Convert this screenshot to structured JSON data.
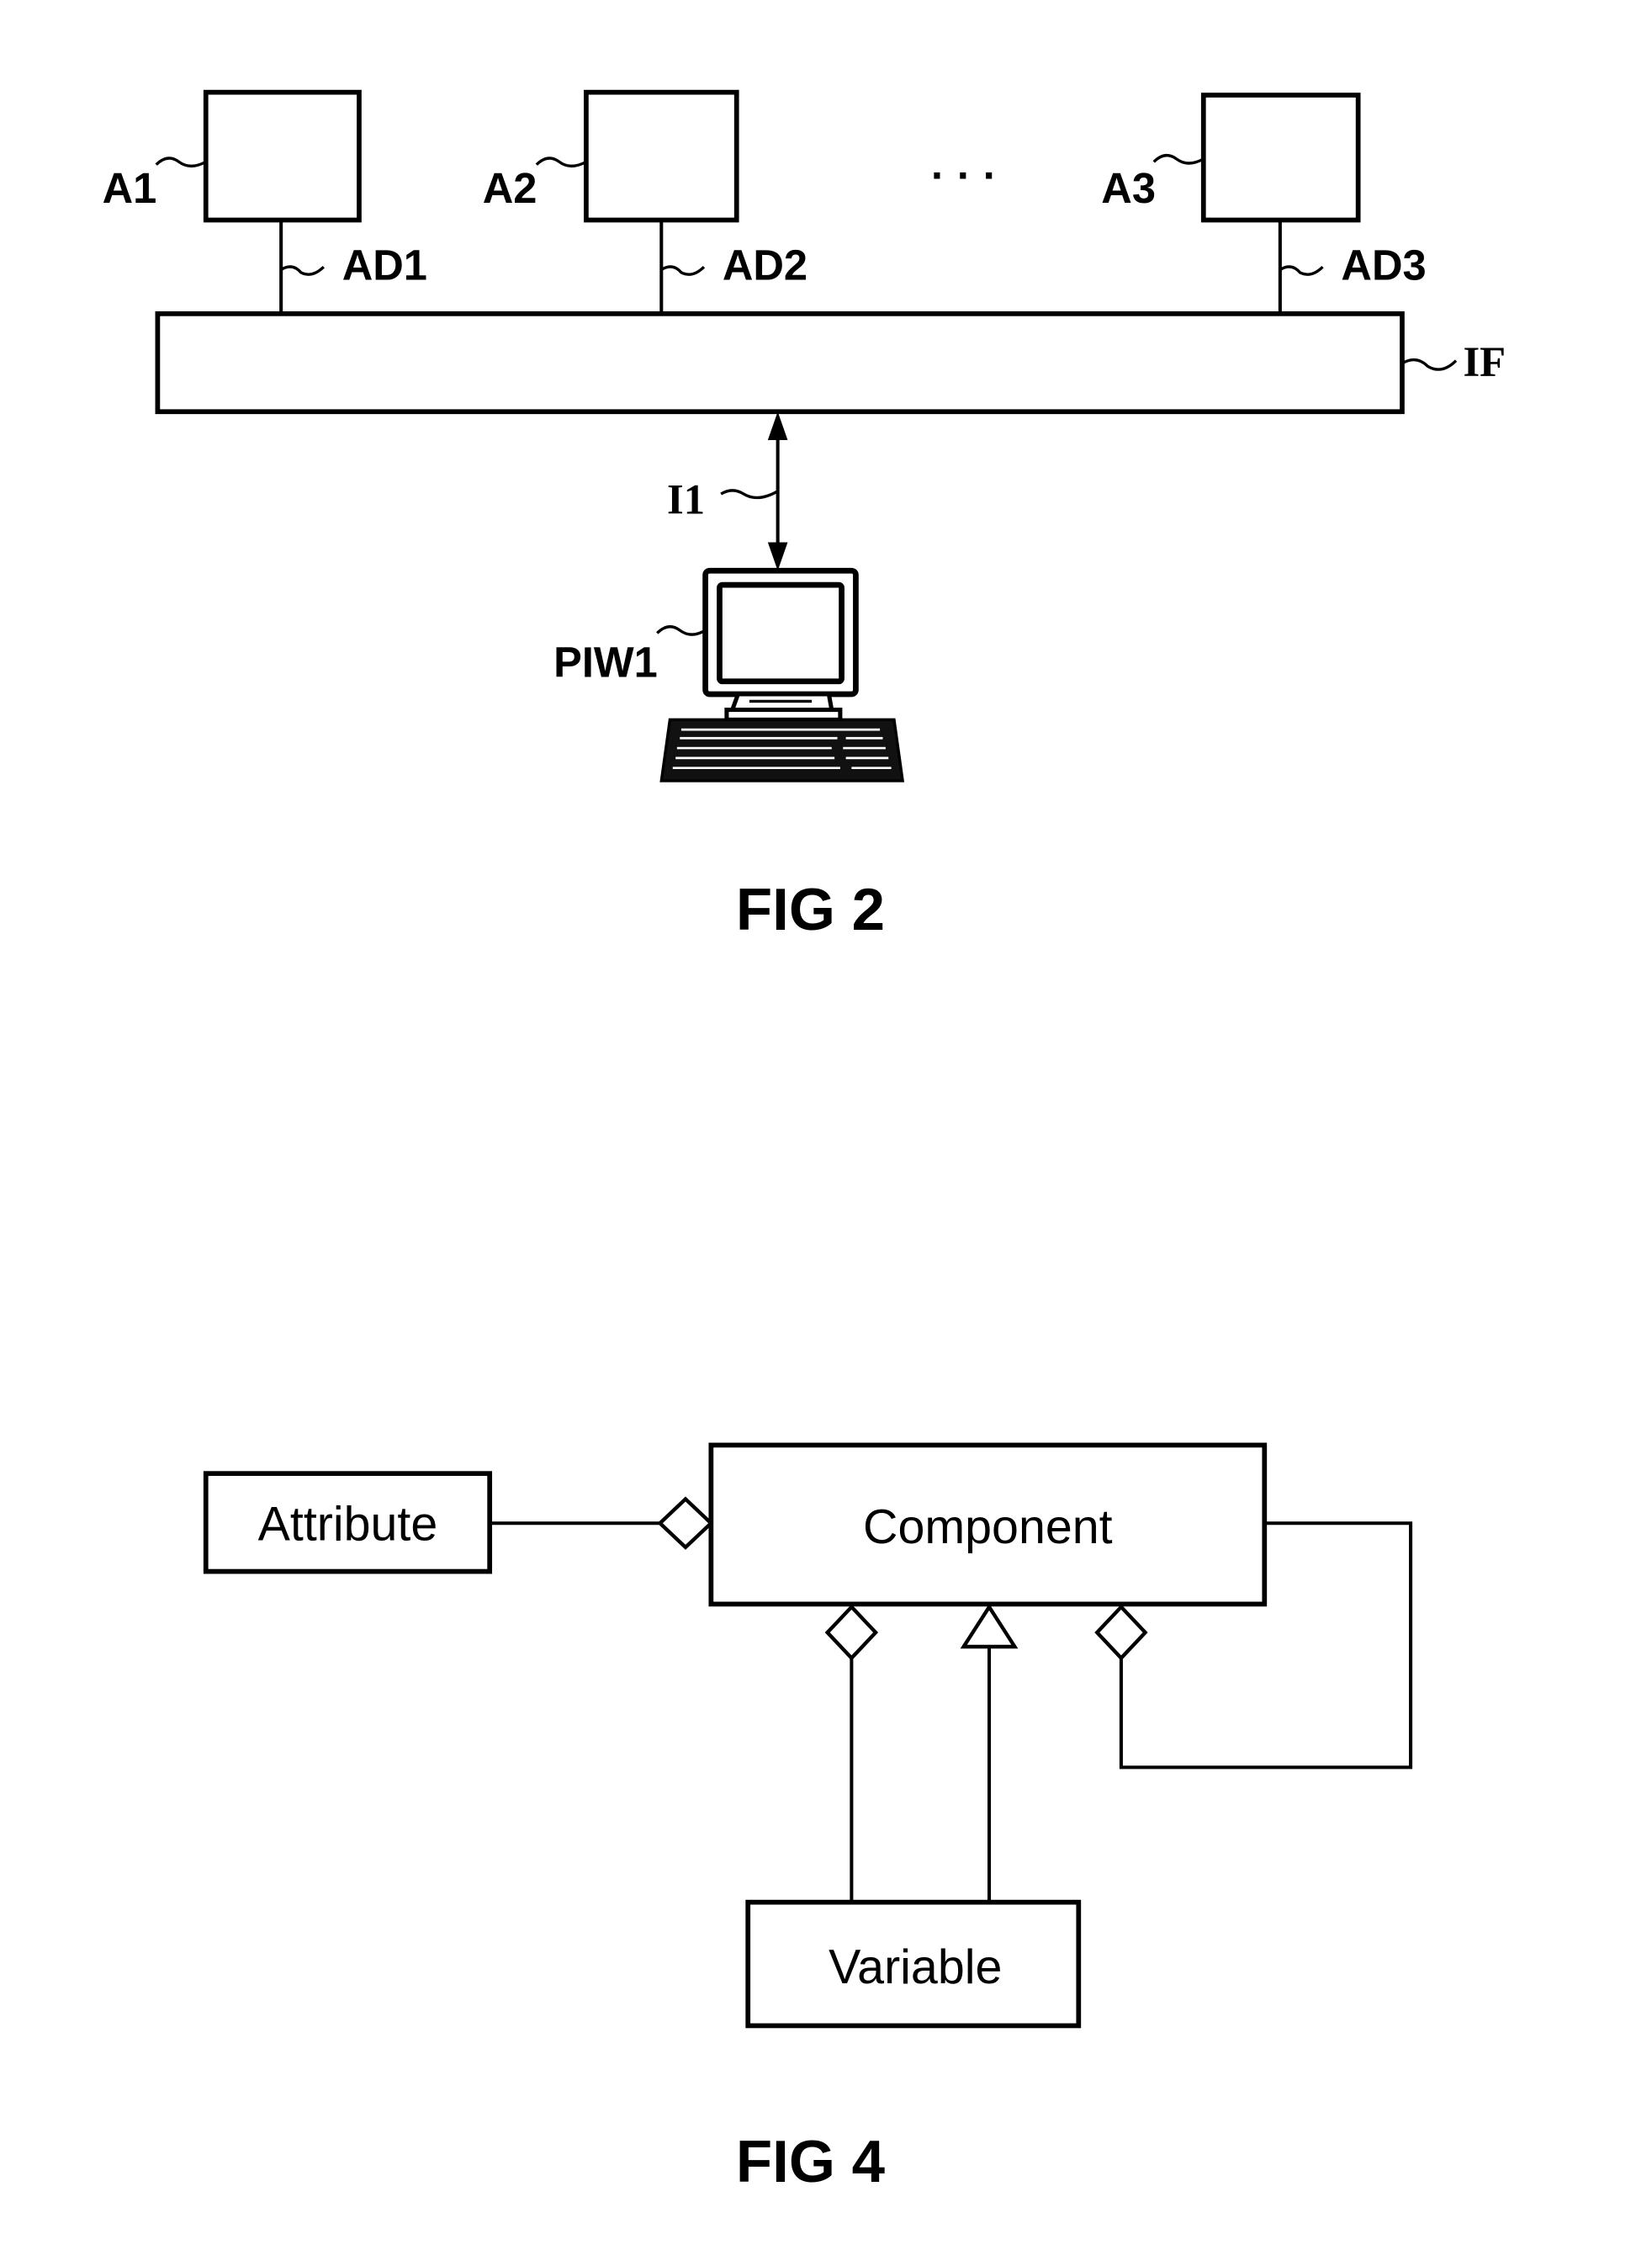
{
  "fig2": {
    "caption": "FIG 2",
    "apps": [
      {
        "label": "A1",
        "link_label": "AD1"
      },
      {
        "label": "A2",
        "link_label": "AD2"
      },
      {
        "label": "A3",
        "link_label": "AD3"
      }
    ],
    "ellipsis": "· · ·",
    "interface_label": "IF",
    "connection_label": "I1",
    "workstation_label": "PIW1",
    "workstation_icon": "computer-icon"
  },
  "fig4": {
    "caption": "FIG 4",
    "classes": {
      "attribute": "Attribute",
      "component": "Component",
      "variable": "Variable"
    },
    "relations": [
      {
        "from": "Attribute",
        "to": "Component",
        "type": "aggregation"
      },
      {
        "from": "Variable",
        "to": "Component",
        "type": "aggregation"
      },
      {
        "from": "Variable",
        "to": "Component",
        "type": "generalization"
      },
      {
        "from": "Component",
        "to": "Component",
        "type": "aggregation"
      }
    ]
  }
}
